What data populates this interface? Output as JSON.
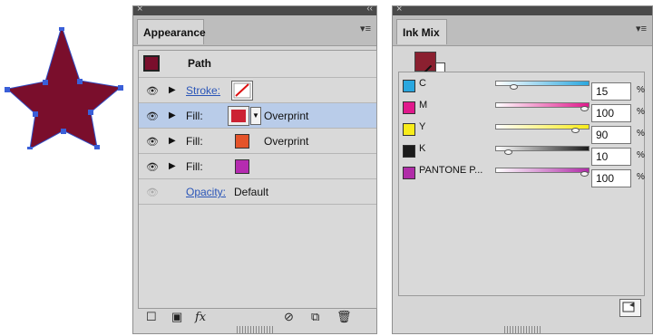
{
  "appearance": {
    "tab_title": "Appearance",
    "header": {
      "label": "Path"
    },
    "rows": [
      {
        "label": "Stroke:",
        "is_link": true,
        "extra": ""
      },
      {
        "label": "Fill:",
        "is_link": false,
        "extra": "Overprint"
      },
      {
        "label": "Fill:",
        "is_link": false,
        "extra": "Overprint"
      },
      {
        "label": "Fill:",
        "is_link": false,
        "extra": ""
      }
    ],
    "opacity": {
      "label": "Opacity:",
      "value": "Default"
    }
  },
  "ink_mix": {
    "tab_title": "Ink Mix",
    "inks": [
      {
        "name": "C",
        "value": "15",
        "unit": "%",
        "color": "#2aa7df"
      },
      {
        "name": "M",
        "value": "100",
        "unit": "%",
        "color": "#e0198c"
      },
      {
        "name": "Y",
        "value": "90",
        "unit": "%",
        "color": "#f8ec1a"
      },
      {
        "name": "K",
        "value": "10",
        "unit": "%",
        "color": "#1b1b1b"
      },
      {
        "name": "PANTONE P...",
        "value": "100",
        "unit": "%",
        "color": "#b02ca8"
      }
    ]
  },
  "colors": {
    "star_fill": "#7a0e2c",
    "fill_1": "#cc2233",
    "fill_2": "#e4532a",
    "fill_3": "#b52bb0",
    "selection": "#b9cce9"
  }
}
